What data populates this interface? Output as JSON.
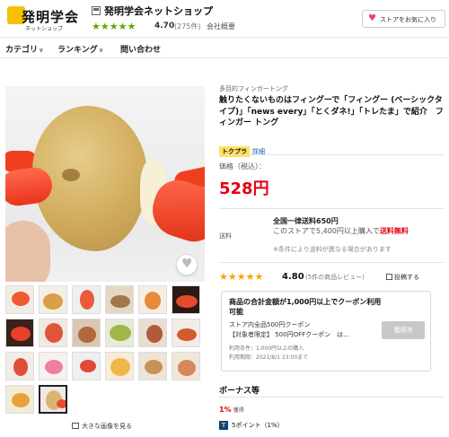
{
  "header": {
    "logo_text": "発明学会",
    "logo_subtext": "ネットショップ",
    "store_name": "発明学会ネットショップ",
    "store_stars": "★★★★★",
    "store_rating": "4.70",
    "store_rating_count": "(275件)",
    "company_link": "会社概要",
    "favorite_store_label": "ストアをお気に入り"
  },
  "nav": {
    "items": [
      {
        "label": "カテゴリ",
        "has_dropdown": true
      },
      {
        "label": "ランキング",
        "has_dropdown": true
      },
      {
        "label": "問い合わせ",
        "has_dropdown": false
      }
    ]
  },
  "gallery": {
    "more_images_label": "大きな画像を見る",
    "thumbnail_count": 19,
    "selected_index": 18
  },
  "product": {
    "category": "多目的フィンガートング",
    "title": "触りたくないものはフィングーで「フィングー (ベーシックタイプ)」「news every」「とくダネ!」「トレたま」で紹介　フィンガー トング",
    "tokutoku_badge": "トクプラ",
    "tokutoku_detail": "詳細",
    "price_label": "価格（税込）：",
    "price": "528円",
    "shipping_label": "送料",
    "shipping_line1": "全国一律送料650円",
    "shipping_line2_prefix": "このストアで5,400円以上購入で",
    "shipping_line2_free": "送料無料",
    "shipping_line3": "※条件により送料が異なる場合があります",
    "review_stars": "★★★★★",
    "review_score": "4.80",
    "review_count": "(5件の商品レビュー)",
    "post_review_label": "投稿する"
  },
  "coupon": {
    "title": "商品の合計金額が1,000円以上でクーポン利用可能",
    "desc1": "ストア内全品500円クーポン",
    "desc2": "【対象者限定】 500円OFFクーポン　は…",
    "condition": "利用条件：1,000円以上の購入",
    "period": "利用期限：2021/8/1 23:00まで",
    "button_label": "獲得済"
  },
  "bonus": {
    "heading": "ボーナス等",
    "percent": "1%",
    "percent_note": "獲得",
    "t_icon": "T",
    "points": "5ポイント（1%）"
  },
  "colors": {
    "price_red": "#e60012",
    "store_star_green": "#5fa800",
    "review_star_orange": "#f5a400",
    "heart_pink": "#e6407a"
  }
}
